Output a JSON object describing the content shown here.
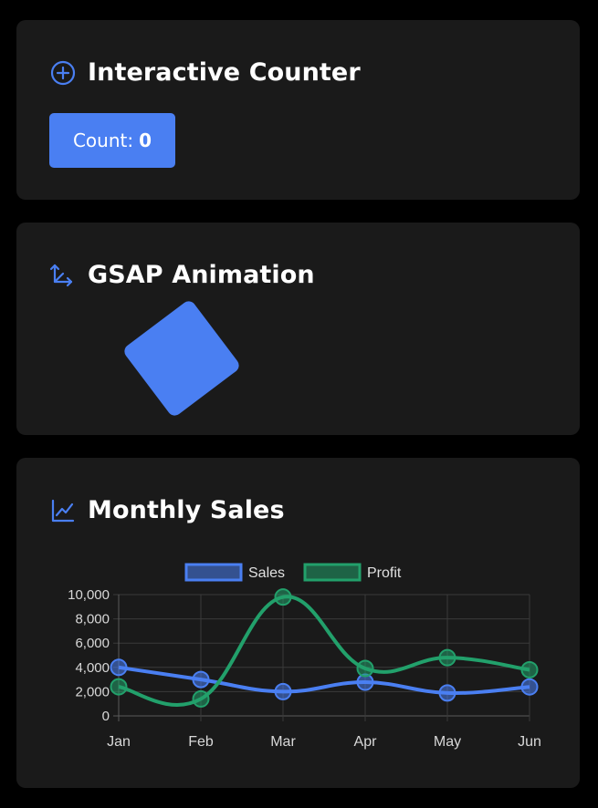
{
  "counter": {
    "title": "Interactive Counter",
    "button_prefix": "Count:",
    "count": "0"
  },
  "animation": {
    "title": "GSAP Animation",
    "box_rotation_deg": -37
  },
  "sales": {
    "title": "Monthly Sales"
  },
  "colors": {
    "accent": "#4a7ff2",
    "profit": "#22a06b",
    "card": "#1a1a1a"
  },
  "chart_data": {
    "type": "line",
    "categories": [
      "Jan",
      "Feb",
      "Mar",
      "Apr",
      "May",
      "Jun"
    ],
    "series": [
      {
        "name": "Sales",
        "color": "#4a7ff2",
        "values": [
          4000,
          3000,
          2000,
          2780,
          1890,
          2390
        ]
      },
      {
        "name": "Profit",
        "color": "#22a06b",
        "values": [
          2400,
          1398,
          9800,
          3908,
          4800,
          3800
        ]
      }
    ],
    "ylim": [
      0,
      10000
    ],
    "yticks": [
      "0",
      "2,000",
      "4,000",
      "6,000",
      "8,000",
      "10,000"
    ],
    "grid": true,
    "legend_position": "top"
  }
}
